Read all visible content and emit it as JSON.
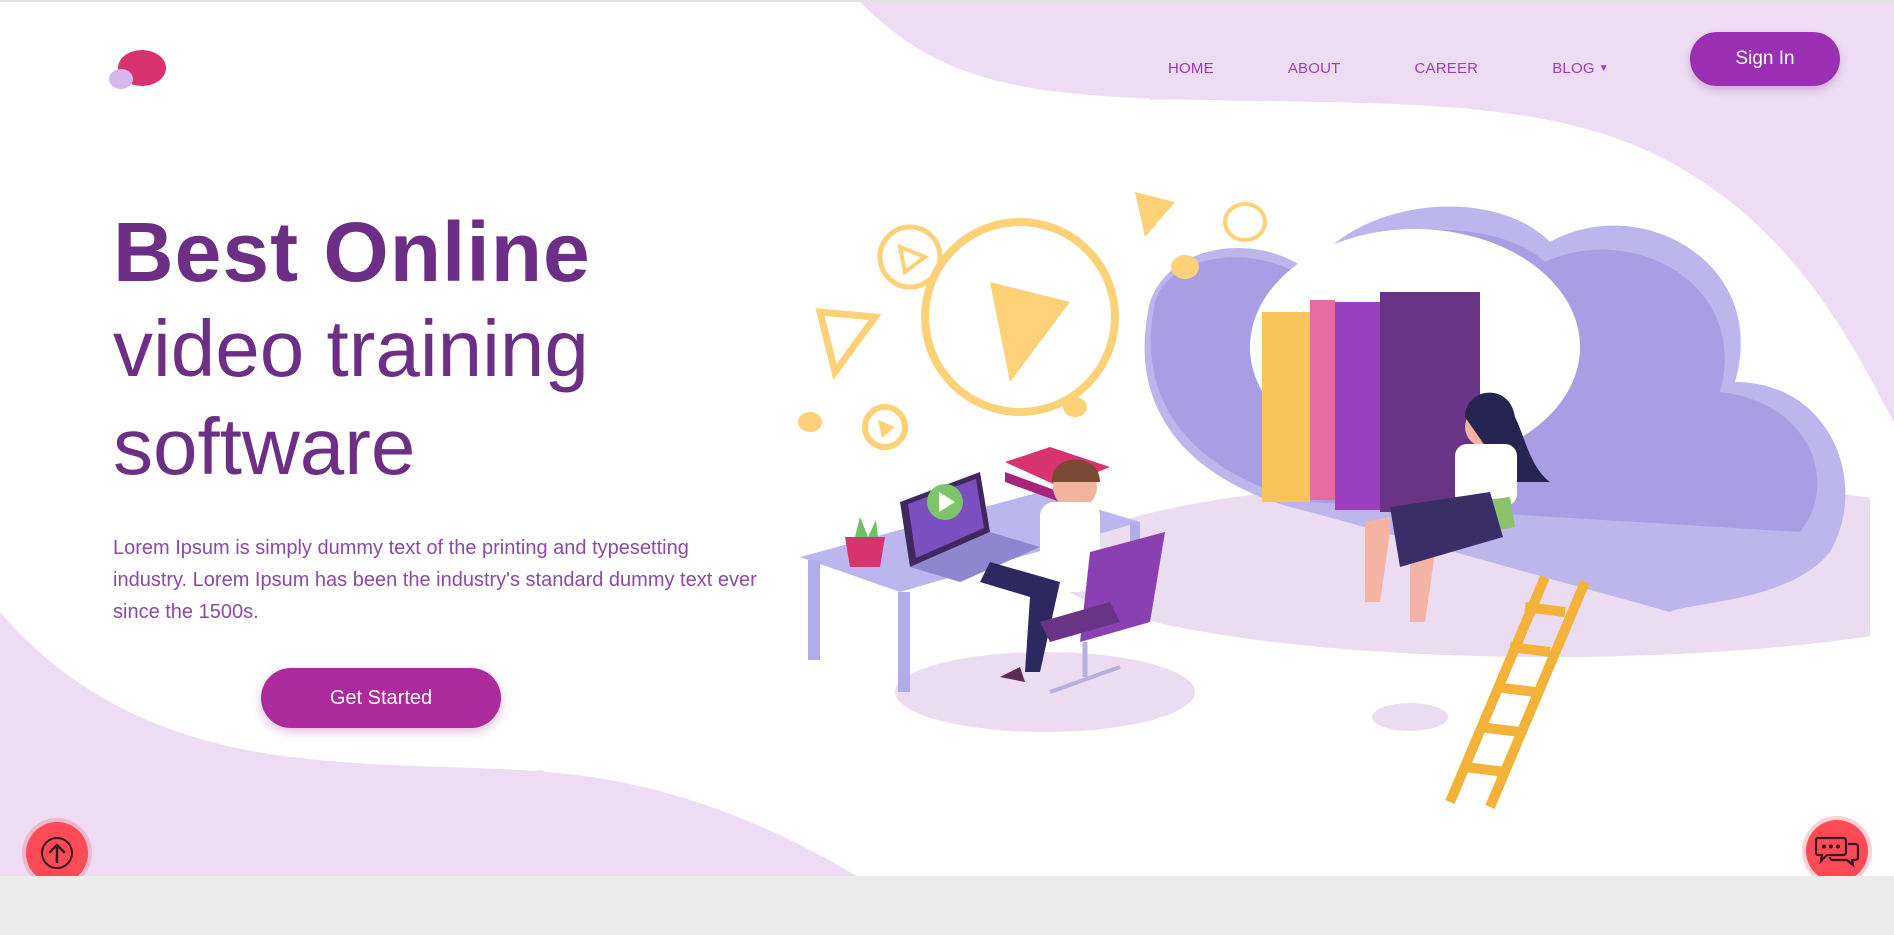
{
  "nav": {
    "items": [
      {
        "label": "HOME",
        "active": true
      },
      {
        "label": "ABOUT",
        "active": false
      },
      {
        "label": "CAREER",
        "active": false
      },
      {
        "label": "BLOG",
        "active": false
      }
    ],
    "signin_label": "Sign In"
  },
  "hero": {
    "title_bold": "Best Online",
    "title_line2": "video training",
    "title_line3": "software",
    "description": "Lorem Ipsum is simply dummy text of the printing and typesetting industry. Lorem Ipsum has been the industry's standard dummy text ever since the 1500s.",
    "cta_label": "Get Started"
  },
  "icons": {
    "logo": "chat-bubbles-logo",
    "scroll_top": "arrow-up-icon",
    "chat": "chat-icon",
    "blog_dropdown": "caret-down-icon"
  },
  "colors": {
    "primary": "#9a2fb3",
    "heading": "#6d2f86",
    "accent_button": "#fc4a57",
    "blob": "#eddcf3"
  }
}
